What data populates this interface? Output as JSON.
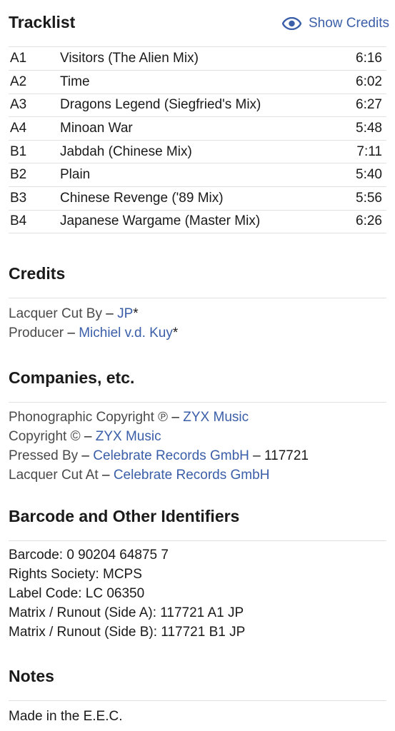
{
  "tracklist": {
    "title": "Tracklist",
    "show_credits_label": "Show Credits",
    "tracks": [
      {
        "position": "A1",
        "title": "Visitors (The Alien Mix)",
        "duration": "6:16"
      },
      {
        "position": "A2",
        "title": "Time",
        "duration": "6:02"
      },
      {
        "position": "A3",
        "title": "Dragons Legend (Siegfried's Mix)",
        "duration": "6:27"
      },
      {
        "position": "A4",
        "title": "Minoan War",
        "duration": "5:48"
      },
      {
        "position": "B1",
        "title": "Jabdah (Chinese Mix)",
        "duration": "7:11"
      },
      {
        "position": "B2",
        "title": "Plain",
        "duration": "5:40"
      },
      {
        "position": "B3",
        "title": "Chinese Revenge ('89 Mix)",
        "duration": "5:56"
      },
      {
        "position": "B4",
        "title": "Japanese Wargame (Master Mix)",
        "duration": "6:26"
      }
    ]
  },
  "credits": {
    "title": "Credits",
    "items": [
      {
        "role": "Lacquer Cut By",
        "separator": " – ",
        "name": "JP",
        "suffix": "*"
      },
      {
        "role": "Producer",
        "separator": " – ",
        "name": "Michiel v.d. Kuy",
        "suffix": "*"
      }
    ]
  },
  "companies": {
    "title": "Companies, etc.",
    "items": [
      {
        "role": "Phonographic Copyright ℗",
        "separator": " – ",
        "name": "ZYX Music",
        "extra": ""
      },
      {
        "role": "Copyright ©",
        "separator": " – ",
        "name": "ZYX Music",
        "extra": ""
      },
      {
        "role": "Pressed By",
        "separator": " – ",
        "name": "Celebrate Records GmbH",
        "extra": " – 117721"
      },
      {
        "role": "Lacquer Cut At",
        "separator": " – ",
        "name": "Celebrate Records GmbH",
        "extra": ""
      }
    ]
  },
  "identifiers": {
    "title": "Barcode and Other Identifiers",
    "items": [
      "Barcode: 0 90204 64875 7",
      "Rights Society: MCPS",
      "Label Code: LC 06350",
      "Matrix / Runout (Side A): 117721 A1 JP",
      "Matrix / Runout (Side B): 117721 B1 JP"
    ]
  },
  "notes": {
    "title": "Notes",
    "text": "Made in the E.E.C."
  },
  "colors": {
    "link": "#3a5ea8",
    "divider": "#e2e2e2"
  },
  "icons": {
    "show_credits": "eye-icon"
  }
}
